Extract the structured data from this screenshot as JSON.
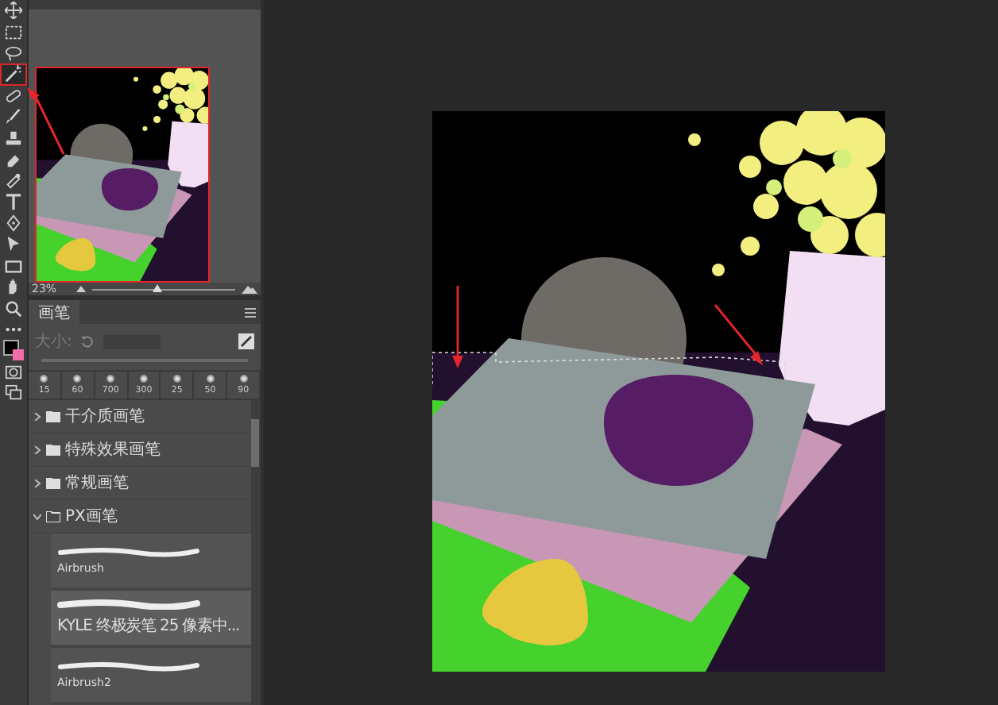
{
  "tools": [
    {
      "kind": "move",
      "selected": false
    },
    {
      "kind": "marquee",
      "selected": false
    },
    {
      "kind": "lasso",
      "selected": false
    },
    {
      "kind": "wand",
      "selected": true
    },
    {
      "kind": "heal",
      "selected": false
    },
    {
      "kind": "brush",
      "selected": false
    },
    {
      "kind": "stamp",
      "selected": false
    },
    {
      "kind": "eraser",
      "selected": false
    },
    {
      "kind": "smudge",
      "selected": false
    },
    {
      "kind": "type",
      "selected": false
    },
    {
      "kind": "pen",
      "selected": false
    },
    {
      "kind": "pointer",
      "selected": false
    },
    {
      "kind": "rect",
      "selected": false
    },
    {
      "kind": "hand",
      "selected": false
    },
    {
      "kind": "zoom",
      "selected": false
    },
    {
      "kind": "more",
      "selected": false
    },
    {
      "kind": "colors",
      "selected": false
    },
    {
      "kind": "mask",
      "selected": false
    },
    {
      "kind": "screen",
      "selected": false
    }
  ],
  "navigator": {
    "zoom": "23%",
    "level": 0.45
  },
  "brushes": {
    "tab": "画笔",
    "size_label": "大小:",
    "tips": [
      "15",
      "60",
      "700",
      "300",
      "25",
      "50",
      "90"
    ],
    "folders": [
      {
        "name": "干介质画笔",
        "expanded": false
      },
      {
        "name": "特殊效果画笔",
        "expanded": false
      },
      {
        "name": "常规画笔",
        "expanded": false
      },
      {
        "name": "PX画笔",
        "expanded": true
      }
    ],
    "presets": [
      {
        "name": "Airbrush",
        "selected": false
      },
      {
        "name": "KYLE 终极炭笔 25 像素中...",
        "selected": true
      },
      {
        "name": "Airbrush2",
        "selected": false
      }
    ]
  }
}
